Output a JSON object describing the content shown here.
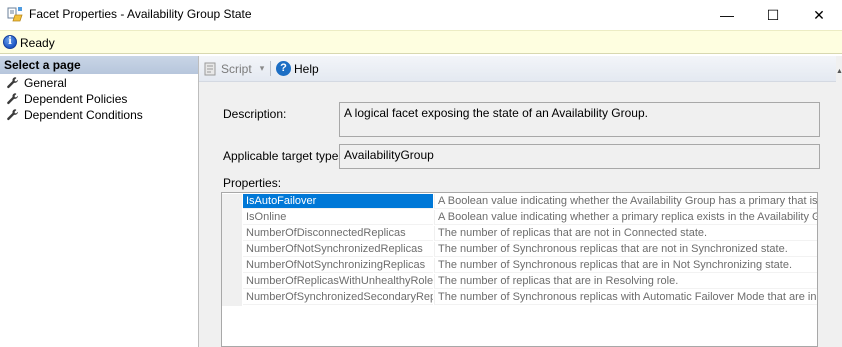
{
  "window": {
    "title": "Facet Properties - Availability Group State",
    "minimize_glyph": "—",
    "maximize_glyph": "☐",
    "close_glyph": "✕"
  },
  "status": {
    "text": "Ready",
    "icon": "info-icon"
  },
  "left_pane": {
    "header": "Select a page",
    "items": [
      {
        "label": "General",
        "icon": "wrench-icon"
      },
      {
        "label": "Dependent Policies",
        "icon": "wrench-icon"
      },
      {
        "label": "Dependent Conditions",
        "icon": "wrench-icon"
      }
    ]
  },
  "toolbar": {
    "script_label": "Script",
    "script_dropdown": "▾",
    "help_label": "Help"
  },
  "form": {
    "description_label": "Description:",
    "description_value": "A logical facet exposing the state of an Availability Group.",
    "target_types_label": "Applicable target types:",
    "target_types_value": "AvailabilityGroup",
    "properties_label": "Properties:"
  },
  "properties": [
    {
      "name": "IsAutoFailover",
      "description": "A Boolean value indicating whether the Availability Group has a primary that is set",
      "selected": true
    },
    {
      "name": "IsOnline",
      "description": "A Boolean value indicating whether a primary replica exists in the Availability Grou"
    },
    {
      "name": "NumberOfDisconnectedReplicas",
      "description": "The number of replicas that are not in Connected state."
    },
    {
      "name": "NumberOfNotSynchronizedReplicas",
      "description": "The number of Synchronous replicas that are not in Synchronized state."
    },
    {
      "name": "NumberOfNotSynchronizingReplicas",
      "description": "The number of Synchronous replicas that are in Not Synchronizing state."
    },
    {
      "name": "NumberOfReplicasWithUnhealthyRole",
      "description": "The number of replicas that are in Resolving role."
    },
    {
      "name": "NumberOfSynchronizedSecondaryRepli",
      "description": "The number of Synchronous replicas with Automatic Failover Mode that are in Syn"
    }
  ],
  "colors": {
    "selection": "#0078d7",
    "status_bar": "#fefee0",
    "content_bg": "#f0f0f0"
  }
}
